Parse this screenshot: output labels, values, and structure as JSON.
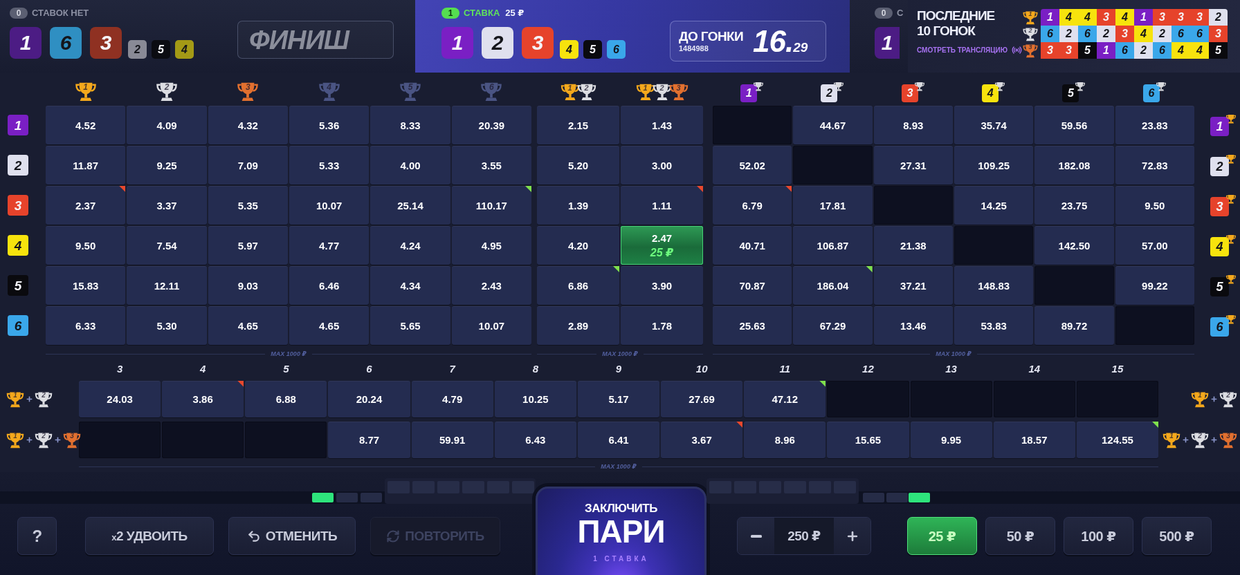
{
  "races": [
    {
      "kind": "finished",
      "active": false,
      "bets_count": "0",
      "bets_label": "СТАВОК НЕТ",
      "podium": [
        {
          "number": "1",
          "color": "#4c1c84"
        },
        {
          "number": "6",
          "color": "#2f8fc2"
        },
        {
          "number": "3",
          "color": "#8f3122"
        }
      ],
      "rest": [
        {
          "number": "2",
          "color": "#898a96"
        },
        {
          "number": "5",
          "color": "#0b0c12"
        },
        {
          "number": "4",
          "color": "#a49a16"
        }
      ],
      "finish_label": "ФИНИШ"
    },
    {
      "kind": "current",
      "active": true,
      "bets_count": "1",
      "bets_label": "СТАВКА",
      "bets_amount": "25 ₽",
      "podium": [
        {
          "number": "1",
          "color": "#7a1fc4"
        },
        {
          "number": "2",
          "color": "#dfe0ee"
        },
        {
          "number": "3",
          "color": "#e6432b"
        }
      ],
      "rest": [
        {
          "number": "4",
          "color": "#f7e30d"
        },
        {
          "number": "5",
          "color": "#0a0a0e"
        },
        {
          "number": "6",
          "color": "#3aa7ea"
        }
      ],
      "countdown_label": "ДО ГОНКИ",
      "race_id": "1484988",
      "countdown": "16.$_{29}$"
    },
    {
      "kind": "next",
      "active": false,
      "bets_count": "0",
      "bets_label": "С",
      "podium": [
        {
          "number": "1",
          "color": "#4c1c84"
        }
      ]
    }
  ],
  "last_races": {
    "title": "ПОСЛЕДНИЕ 10 ГОНОК",
    "watch_label": "СМОТРЕТЬ ТРАНСЛЯЦИЮ",
    "places": [
      {
        "trophy": {
          "number": "1",
          "color": "#f4a81c"
        },
        "results": [
          {
            "number": "1",
            "color": "#7a1fc4"
          },
          {
            "number": "4",
            "color": "#f7e30d"
          },
          {
            "number": "4",
            "color": "#f7e30d"
          },
          {
            "number": "3",
            "color": "#e6432b"
          },
          {
            "number": "4",
            "color": "#f7e30d"
          },
          {
            "number": "1",
            "color": "#7a1fc4"
          },
          {
            "number": "3",
            "color": "#e6432b"
          },
          {
            "number": "3",
            "color": "#e6432b"
          },
          {
            "number": "3",
            "color": "#e6432b"
          },
          {
            "number": "2",
            "color": "#dfe0ee"
          }
        ]
      },
      {
        "trophy": {
          "number": "2",
          "color": "#dcdde2"
        },
        "results": [
          {
            "number": "6",
            "color": "#3aa7ea"
          },
          {
            "number": "2",
            "color": "#dfe0ee"
          },
          {
            "number": "6",
            "color": "#3aa7ea"
          },
          {
            "number": "2",
            "color": "#dfe0ee"
          },
          {
            "number": "3",
            "color": "#e6432b"
          },
          {
            "number": "4",
            "color": "#f7e30d"
          },
          {
            "number": "2",
            "color": "#dfe0ee"
          },
          {
            "number": "6",
            "color": "#3aa7ea"
          },
          {
            "number": "6",
            "color": "#3aa7ea"
          },
          {
            "number": "3",
            "color": "#e6432b"
          }
        ]
      },
      {
        "trophy": {
          "number": "3",
          "color": "#e2702f"
        },
        "results": [
          {
            "number": "3",
            "color": "#e6432b"
          },
          {
            "number": "3",
            "color": "#e6432b"
          },
          {
            "number": "5",
            "color": "#0a0a0e"
          },
          {
            "number": "1",
            "color": "#7a1fc4"
          },
          {
            "number": "6",
            "color": "#3aa7ea"
          },
          {
            "number": "2",
            "color": "#dfe0ee"
          },
          {
            "number": "6",
            "color": "#3aa7ea"
          },
          {
            "number": "4",
            "color": "#f7e30d"
          },
          {
            "number": "4",
            "color": "#f7e30d"
          },
          {
            "number": "5",
            "color": "#0a0a0e"
          }
        ]
      }
    ]
  },
  "board": {
    "place_headers": [
      {
        "number": "1",
        "color": "#f4a81c"
      },
      {
        "number": "2",
        "color": "#dcdde2"
      },
      {
        "number": "3",
        "color": "#e2702f"
      },
      {
        "number": "4",
        "color": "#4a5483"
      },
      {
        "number": "5",
        "color": "#4a5483"
      },
      {
        "number": "6",
        "color": "#4a5483"
      }
    ],
    "combo_headers": [
      {
        "trophies": [
          {
            "number": "1",
            "color": "#f4a81c"
          },
          {
            "number": "2",
            "color": "#dcdde2"
          }
        ]
      },
      {
        "trophies": [
          {
            "number": "1",
            "color": "#f4a81c"
          },
          {
            "number": "2",
            "color": "#dcdde2"
          },
          {
            "number": "3",
            "color": "#e2702f"
          }
        ]
      }
    ],
    "pair_headers": [
      {
        "number": "1",
        "color": "#7a1fc4"
      },
      {
        "number": "2",
        "color": "#dfe0ee"
      },
      {
        "number": "3",
        "color": "#e6432b"
      },
      {
        "number": "4",
        "color": "#f7e30d"
      },
      {
        "number": "5",
        "color": "#0a0a0e"
      },
      {
        "number": "6",
        "color": "#3aa7ea"
      }
    ],
    "rows": [
      {
        "runner": {
          "number": "1",
          "color": "#7a1fc4"
        },
        "places": [
          {
            "kind": "odds",
            "odds": "4.52",
            "rising": false,
            "falling": false,
            "selected": false
          },
          {
            "kind": "odds",
            "odds": "4.09",
            "rising": false,
            "falling": false,
            "selected": false
          },
          {
            "kind": "odds",
            "odds": "4.32",
            "rising": false,
            "falling": false,
            "selected": false
          },
          {
            "kind": "odds",
            "odds": "5.36",
            "rising": false,
            "falling": false,
            "selected": false
          },
          {
            "kind": "odds",
            "odds": "8.33",
            "rising": false,
            "falling": false,
            "selected": false
          },
          {
            "kind": "odds",
            "odds": "20.39",
            "rising": false,
            "falling": false,
            "selected": false
          }
        ],
        "combos": [
          {
            "kind": "odds",
            "odds": "2.15",
            "rising": false,
            "falling": false,
            "selected": false
          },
          {
            "kind": "odds",
            "odds": "1.43",
            "rising": false,
            "falling": false,
            "selected": false
          }
        ],
        "pairs": [
          {
            "kind": "empty"
          },
          {
            "kind": "odds",
            "odds": "44.67",
            "rising": false,
            "falling": false,
            "selected": false
          },
          {
            "kind": "odds",
            "odds": "8.93",
            "rising": false,
            "falling": false,
            "selected": false
          },
          {
            "kind": "odds",
            "odds": "35.74",
            "rising": false,
            "falling": false,
            "selected": false
          },
          {
            "kind": "odds",
            "odds": "59.56",
            "rising": false,
            "falling": false,
            "selected": false
          },
          {
            "kind": "odds",
            "odds": "23.83",
            "rising": false,
            "falling": false,
            "selected": false
          }
        ],
        "winner": {
          "number": "1",
          "color": "#7a1fc4"
        }
      },
      {
        "runner": {
          "number": "2",
          "color": "#dfe0ee"
        },
        "places": [
          {
            "kind": "odds",
            "odds": "11.87",
            "rising": false,
            "falling": false,
            "selected": false
          },
          {
            "kind": "odds",
            "odds": "9.25",
            "rising": false,
            "falling": false,
            "selected": false
          },
          {
            "kind": "odds",
            "odds": "7.09",
            "rising": false,
            "falling": false,
            "selected": false
          },
          {
            "kind": "odds",
            "odds": "5.33",
            "rising": false,
            "falling": false,
            "selected": false
          },
          {
            "kind": "odds",
            "odds": "4.00",
            "rising": false,
            "falling": false,
            "selected": false
          },
          {
            "kind": "odds",
            "odds": "3.55",
            "rising": false,
            "falling": false,
            "selected": false
          }
        ],
        "combos": [
          {
            "kind": "odds",
            "odds": "5.20",
            "rising": false,
            "falling": false,
            "selected": false
          },
          {
            "kind": "odds",
            "odds": "3.00",
            "rising": false,
            "falling": false,
            "selected": false
          }
        ],
        "pairs": [
          {
            "kind": "odds",
            "odds": "52.02",
            "rising": false,
            "falling": false,
            "selected": false
          },
          {
            "kind": "empty"
          },
          {
            "kind": "odds",
            "odds": "27.31",
            "rising": false,
            "falling": false,
            "selected": false
          },
          {
            "kind": "odds",
            "odds": "109.25",
            "rising": false,
            "falling": false,
            "selected": false
          },
          {
            "kind": "odds",
            "odds": "182.08",
            "rising": false,
            "falling": false,
            "selected": false
          },
          {
            "kind": "odds",
            "odds": "72.83",
            "rising": false,
            "falling": false,
            "selected": false
          }
        ],
        "winner": {
          "number": "2",
          "color": "#dfe0ee"
        }
      },
      {
        "runner": {
          "number": "3",
          "color": "#e6432b"
        },
        "places": [
          {
            "kind": "odds",
            "odds": "2.37",
            "rising": false,
            "falling": true,
            "selected": false
          },
          {
            "kind": "odds",
            "odds": "3.37",
            "rising": false,
            "falling": false,
            "selected": false
          },
          {
            "kind": "odds",
            "odds": "5.35",
            "rising": false,
            "falling": false,
            "selected": false
          },
          {
            "kind": "odds",
            "odds": "10.07",
            "rising": false,
            "falling": false,
            "selected": false
          },
          {
            "kind": "odds",
            "odds": "25.14",
            "rising": false,
            "falling": false,
            "selected": false
          },
          {
            "kind": "odds",
            "odds": "110.17",
            "rising": true,
            "falling": false,
            "selected": false
          }
        ],
        "combos": [
          {
            "kind": "odds",
            "odds": "1.39",
            "rising": false,
            "falling": false,
            "selected": false
          },
          {
            "kind": "odds",
            "odds": "1.11",
            "rising": false,
            "falling": true,
            "selected": false
          }
        ],
        "pairs": [
          {
            "kind": "odds",
            "odds": "6.79",
            "rising": false,
            "falling": true,
            "selected": false
          },
          {
            "kind": "odds",
            "odds": "17.81",
            "rising": false,
            "falling": false,
            "selected": false
          },
          {
            "kind": "empty"
          },
          {
            "kind": "odds",
            "odds": "14.25",
            "rising": false,
            "falling": false,
            "selected": false
          },
          {
            "kind": "odds",
            "odds": "23.75",
            "rising": false,
            "falling": false,
            "selected": false
          },
          {
            "kind": "odds",
            "odds": "9.50",
            "rising": false,
            "falling": false,
            "selected": false
          }
        ],
        "winner": {
          "number": "3",
          "color": "#e6432b"
        }
      },
      {
        "runner": {
          "number": "4",
          "color": "#f7e30d"
        },
        "places": [
          {
            "kind": "odds",
            "odds": "9.50",
            "rising": false,
            "falling": false,
            "selected": false
          },
          {
            "kind": "odds",
            "odds": "7.54",
            "rising": false,
            "falling": false,
            "selected": false
          },
          {
            "kind": "odds",
            "odds": "5.97",
            "rising": false,
            "falling": false,
            "selected": false
          },
          {
            "kind": "odds",
            "odds": "4.77",
            "rising": false,
            "falling": false,
            "selected": false
          },
          {
            "kind": "odds",
            "odds": "4.24",
            "rising": false,
            "falling": false,
            "selected": false
          },
          {
            "kind": "odds",
            "odds": "4.95",
            "rising": false,
            "falling": false,
            "selected": false
          }
        ],
        "combos": [
          {
            "kind": "odds",
            "odds": "4.20",
            "rising": false,
            "falling": false,
            "selected": false
          },
          {
            "kind": "odds",
            "odds": "2.47",
            "rising": false,
            "falling": false,
            "selected": true,
            "stake": "25 ₽"
          }
        ],
        "pairs": [
          {
            "kind": "odds",
            "odds": "40.71",
            "rising": false,
            "falling": false,
            "selected": false
          },
          {
            "kind": "odds",
            "odds": "106.87",
            "rising": false,
            "falling": false,
            "selected": false
          },
          {
            "kind": "odds",
            "odds": "21.38",
            "rising": false,
            "falling": false,
            "selected": false
          },
          {
            "kind": "empty"
          },
          {
            "kind": "odds",
            "odds": "142.50",
            "rising": false,
            "falling": false,
            "selected": false
          },
          {
            "kind": "odds",
            "odds": "57.00",
            "rising": false,
            "falling": false,
            "selected": false
          }
        ],
        "winner": {
          "number": "4",
          "color": "#f7e30d"
        }
      },
      {
        "runner": {
          "number": "5",
          "color": "#0a0a0e"
        },
        "places": [
          {
            "kind": "odds",
            "odds": "15.83",
            "rising": false,
            "falling": false,
            "selected": false
          },
          {
            "kind": "odds",
            "odds": "12.11",
            "rising": false,
            "falling": false,
            "selected": false
          },
          {
            "kind": "odds",
            "odds": "9.03",
            "rising": false,
            "falling": false,
            "selected": false
          },
          {
            "kind": "odds",
            "odds": "6.46",
            "rising": false,
            "falling": false,
            "selected": false
          },
          {
            "kind": "odds",
            "odds": "4.34",
            "rising": false,
            "falling": false,
            "selected": false
          },
          {
            "kind": "odds",
            "odds": "2.43",
            "rising": false,
            "falling": false,
            "selected": false
          }
        ],
        "combos": [
          {
            "kind": "odds",
            "odds": "6.86",
            "rising": true,
            "falling": false,
            "selected": false
          },
          {
            "kind": "odds",
            "odds": "3.90",
            "rising": false,
            "falling": false,
            "selected": false
          }
        ],
        "pairs": [
          {
            "kind": "odds",
            "odds": "70.87",
            "rising": false,
            "falling": false,
            "selected": false
          },
          {
            "kind": "odds",
            "odds": "186.04",
            "rising": true,
            "falling": false,
            "selected": false
          },
          {
            "kind": "odds",
            "odds": "37.21",
            "rising": false,
            "falling": false,
            "selected": false
          },
          {
            "kind": "odds",
            "odds": "148.83",
            "rising": false,
            "falling": false,
            "selected": false
          },
          {
            "kind": "empty"
          },
          {
            "kind": "odds",
            "odds": "99.22",
            "rising": false,
            "falling": false,
            "selected": false
          }
        ],
        "winner": {
          "number": "5",
          "color": "#0a0a0e"
        }
      },
      {
        "runner": {
          "number": "6",
          "color": "#3aa7ea"
        },
        "places": [
          {
            "kind": "odds",
            "odds": "6.33",
            "rising": false,
            "falling": false,
            "selected": false
          },
          {
            "kind": "odds",
            "odds": "5.30",
            "rising": false,
            "falling": false,
            "selected": false
          },
          {
            "kind": "odds",
            "odds": "4.65",
            "rising": false,
            "falling": false,
            "selected": false
          },
          {
            "kind": "odds",
            "odds": "4.65",
            "rising": false,
            "falling": false,
            "selected": false
          },
          {
            "kind": "odds",
            "odds": "5.65",
            "rising": false,
            "falling": false,
            "selected": false
          },
          {
            "kind": "odds",
            "odds": "10.07",
            "rising": false,
            "falling": false,
            "selected": false
          }
        ],
        "combos": [
          {
            "kind": "odds",
            "odds": "2.89",
            "rising": false,
            "falling": false,
            "selected": false
          },
          {
            "kind": "odds",
            "odds": "1.78",
            "rising": false,
            "falling": false,
            "selected": false
          }
        ],
        "pairs": [
          {
            "kind": "odds",
            "odds": "25.63",
            "rising": false,
            "falling": false,
            "selected": false
          },
          {
            "kind": "odds",
            "odds": "67.29",
            "rising": false,
            "falling": false,
            "selected": false
          },
          {
            "kind": "odds",
            "odds": "13.46",
            "rising": false,
            "falling": false,
            "selected": false
          },
          {
            "kind": "odds",
            "odds": "53.83",
            "rising": false,
            "falling": false,
            "selected": false
          },
          {
            "kind": "odds",
            "odds": "89.72",
            "rising": false,
            "falling": false,
            "selected": false
          },
          {
            "kind": "empty"
          }
        ],
        "winner": {
          "number": "6",
          "color": "#3aa7ea"
        }
      }
    ],
    "limit_labels": [
      "MAX 1000 ₽",
      "MAX 1000 ₽",
      "MAX 1000 ₽"
    ]
  },
  "combos": {
    "columns": [
      "3",
      "4",
      "5",
      "6",
      "7",
      "8",
      "9",
      "10",
      "11",
      "12",
      "13",
      "14",
      "15"
    ],
    "rows": [
      {
        "label": [
          {
            "number": "1",
            "color": "#f4a81c"
          },
          {
            "number": "2",
            "color": "#dcdde2"
          }
        ],
        "cells": [
          {
            "kind": "odds",
            "odds": "24.03",
            "rising": false,
            "falling": false,
            "selected": false
          },
          {
            "kind": "odds",
            "odds": "3.86",
            "rising": false,
            "falling": true,
            "selected": false
          },
          {
            "kind": "odds",
            "odds": "6.88",
            "rising": false,
            "falling": false,
            "selected": false
          },
          {
            "kind": "odds",
            "odds": "20.24",
            "rising": false,
            "falling": false,
            "selected": false
          },
          {
            "kind": "odds",
            "odds": "4.79",
            "rising": false,
            "falling": false,
            "selected": false
          },
          {
            "kind": "odds",
            "odds": "10.25",
            "rising": false,
            "falling": false,
            "selected": false
          },
          {
            "kind": "odds",
            "odds": "5.17",
            "rising": false,
            "falling": false,
            "selected": false
          },
          {
            "kind": "odds",
            "odds": "27.69",
            "rising": false,
            "falling": false,
            "selected": false
          },
          {
            "kind": "odds",
            "odds": "47.12",
            "rising": true,
            "falling": false,
            "selected": false
          },
          {
            "kind": "empty"
          },
          {
            "kind": "empty"
          },
          {
            "kind": "empty"
          },
          {
            "kind": "empty"
          }
        ],
        "label_right": [
          {
            "number": "1",
            "color": "#f4a81c"
          },
          {
            "number": "2",
            "color": "#dcdde2"
          }
        ]
      },
      {
        "label": [
          {
            "number": "1",
            "color": "#f4a81c"
          },
          {
            "number": "2",
            "color": "#dcdde2"
          },
          {
            "number": "3",
            "color": "#e2702f"
          }
        ],
        "cells": [
          {
            "kind": "empty"
          },
          {
            "kind": "empty"
          },
          {
            "kind": "empty"
          },
          {
            "kind": "odds",
            "odds": "8.77",
            "rising": false,
            "falling": false,
            "selected": false
          },
          {
            "kind": "odds",
            "odds": "59.91",
            "rising": false,
            "falling": false,
            "selected": false
          },
          {
            "kind": "odds",
            "odds": "6.43",
            "rising": false,
            "falling": false,
            "selected": false
          },
          {
            "kind": "odds",
            "odds": "6.41",
            "rising": false,
            "falling": false,
            "selected": false
          },
          {
            "kind": "odds",
            "odds": "3.67",
            "rising": false,
            "falling": true,
            "selected": false
          },
          {
            "kind": "odds",
            "odds": "8.96",
            "rising": false,
            "falling": false,
            "selected": false
          },
          {
            "kind": "odds",
            "odds": "15.65",
            "rising": false,
            "falling": false,
            "selected": false
          },
          {
            "kind": "odds",
            "odds": "9.95",
            "rising": false,
            "falling": false,
            "selected": false
          },
          {
            "kind": "odds",
            "odds": "18.57",
            "rising": false,
            "falling": false,
            "selected": false
          },
          {
            "kind": "odds",
            "odds": "124.55",
            "rising": true,
            "falling": false,
            "selected": false
          }
        ],
        "label_right": [
          {
            "number": "1",
            "color": "#f4a81c"
          },
          {
            "number": "2",
            "color": "#dcdde2"
          },
          {
            "number": "3",
            "color": "#e2702f"
          }
        ]
      }
    ],
    "limit_label": "MAX 1000 ₽"
  },
  "toolbar": {
    "help_label": "?",
    "double_label": "x2 УДВОИТЬ",
    "undo_label": "ОТМЕНИТЬ",
    "repeat": {
      "label": "ПОВТОРИТЬ",
      "disabled": true
    },
    "place_bet": {
      "title_top": "ЗАКЛЮЧИТЬ",
      "title_main": "ПАРИ",
      "bets_count": "1 СТАВКА"
    },
    "stake": "250 ₽",
    "chips": [
      {
        "label": "25 ₽",
        "selected": true
      },
      {
        "label": "50 ₽",
        "selected": false
      },
      {
        "label": "100 ₽",
        "selected": false
      },
      {
        "label": "500 ₽",
        "selected": false
      }
    ]
  }
}
